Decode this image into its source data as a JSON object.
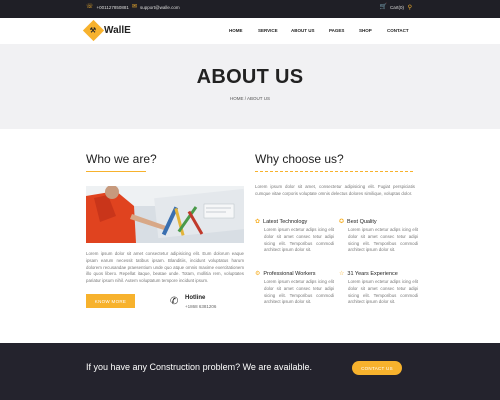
{
  "topbar": {
    "phone": "+001127850881",
    "email": "support@walle.com",
    "cart": "Cart(0)"
  },
  "logo": {
    "text": "WallE"
  },
  "nav": [
    "HOME",
    "SERVICE",
    "ABOUT US",
    "PAGES",
    "SHOP",
    "CONTACT"
  ],
  "hero": {
    "title": "ABOUT US",
    "breadcrumb": "HOME / ABOUT US"
  },
  "who": {
    "heading": "Who we are?",
    "body": "Lorem ipsum dolor sit amet consectetur adipisicing elit. Eum dolorum eaque ipsam earum necessit tatibus ipsam. Blanditiis, incidunt voluptatus harum dolorem recusandae praesentium unde quo atque omnis maxime exercitationem illo quos libero. Repellat itaque, beatae unde. Totam, mollitia rem, voluptates pariatur ipsum nihil. Autem voluptatum tempore incidunt ipsum.",
    "button": "KNOW MORE",
    "hotline_title": "Hotline",
    "hotline_number": "+1868 6381206"
  },
  "why": {
    "heading": "Why choose us?",
    "intro": "Lorem ipsum dolor sit amet, consectetur adipisicing elit. Fugiat perspiciatis cumque vitae corporis voluptate omnis delectus dolores similique, voluptas dolor.",
    "features": [
      {
        "title": "Latest Technology",
        "text": "Lorem ipsum ectetur adips icing elit dolor sit amet consec tetur adipi sicing elit. Temporibus commodi architect ipsum dolor sit."
      },
      {
        "title": "Best Quality",
        "text": "Lorem ipsum ectetur adips icing elit dolor sit amet consec tetur adipi sicing elit. Temporibus commodi architect ipsum dolor sit."
      },
      {
        "title": "Professional Workers",
        "text": "Lorem ipsum ectetur adips icing elit dolor sit amet consec tetur adipi sicing elit. Temporibus commodi architect ipsum dolor sit."
      },
      {
        "title": "31 Years Experience",
        "text": "Lorem ipsum ectetur adips icing elit dolor sit amet consec tetur adipi sicing elit. Temporibus commodi architect ipsum dolor sit."
      }
    ]
  },
  "footer": {
    "message": "If you have any Construction problem? We are available.",
    "button": "CONTACT US"
  },
  "colors": {
    "accent": "#f7b22d",
    "dark": "#24232d",
    "hero_bg": "#f1f1f3"
  },
  "icons": [
    "phone-icon",
    "mail-icon",
    "cart-icon",
    "search-icon",
    "bulb-icon",
    "medal-icon",
    "workers-icon",
    "trophy-icon",
    "hotline-phone-icon"
  ]
}
